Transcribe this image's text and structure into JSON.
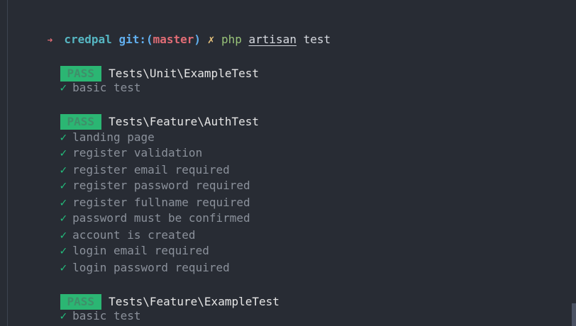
{
  "prompt": {
    "arrow": "➜",
    "directory": "credpal",
    "git_label": "git:(",
    "branch": "master",
    "git_close": ")",
    "dirty_mark": "✗",
    "command": "php",
    "arg1": "artisan",
    "arg2": "test"
  },
  "suites": [
    {
      "badge": "PASS",
      "name": "Tests\\Unit\\ExampleTest",
      "tests": [
        "basic test"
      ]
    },
    {
      "badge": "PASS",
      "name": "Tests\\Feature\\AuthTest",
      "tests": [
        "landing page",
        "register validation",
        "register email required",
        "register password required",
        "register fullname required",
        "password must be confirmed",
        "account is created",
        "login email required",
        "login password required"
      ]
    },
    {
      "badge": "PASS",
      "name": "Tests\\Feature\\ExampleTest",
      "tests": [
        "basic test"
      ]
    }
  ],
  "check_mark": "✓",
  "colors": {
    "background": "#282c34",
    "pass_badge": "#2bb673",
    "check": "#23c07d",
    "branch": "#e06c75",
    "directory": "#56b6c2"
  }
}
